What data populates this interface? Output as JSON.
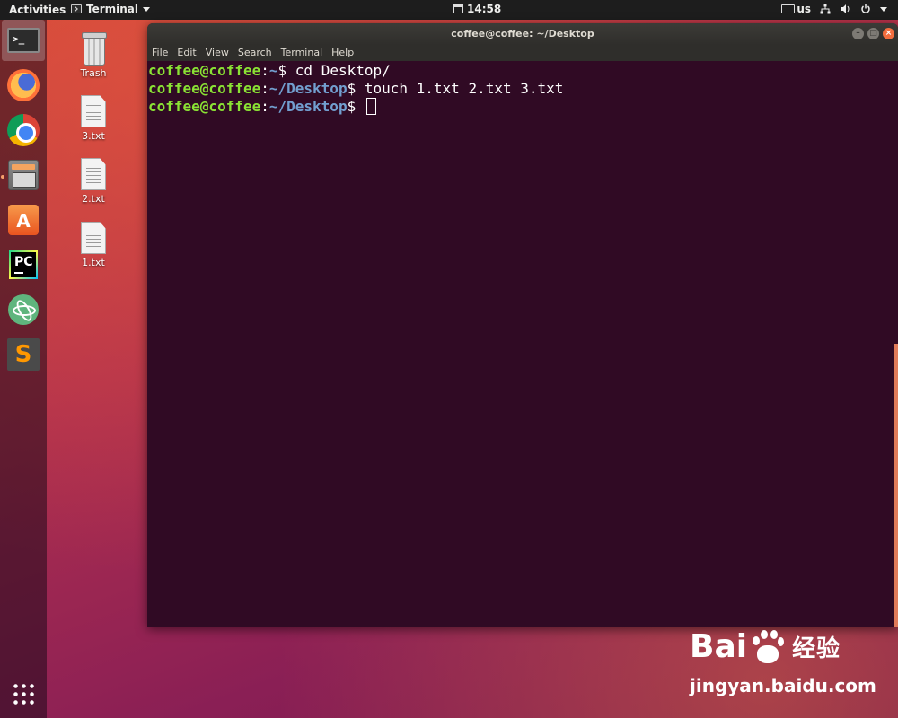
{
  "topbar": {
    "activities": "Activities",
    "app_menu": "Terminal",
    "clock": "14:58",
    "keyboard_layout": "us"
  },
  "dock": {
    "items": [
      {
        "name": "terminal",
        "icon": "terminal-icon",
        "glyph": ">_",
        "active": true
      },
      {
        "name": "firefox",
        "icon": "firefox-icon"
      },
      {
        "name": "chrome",
        "icon": "chrome-icon"
      },
      {
        "name": "files",
        "icon": "files-icon"
      },
      {
        "name": "ubuntu-software",
        "icon": "software-center-icon",
        "glyph": "A"
      },
      {
        "name": "pycharm",
        "icon": "pycharm-icon",
        "glyph": "PC"
      },
      {
        "name": "atom",
        "icon": "atom-icon"
      },
      {
        "name": "sublime-text",
        "icon": "sublime-icon",
        "glyph": "S"
      },
      {
        "name": "show-applications",
        "icon": "app-grid-icon"
      }
    ]
  },
  "desktop": {
    "icons": [
      {
        "label": "Trash",
        "icon": "trash-icon"
      },
      {
        "label": "3.txt",
        "icon": "text-file-icon"
      },
      {
        "label": "2.txt",
        "icon": "text-file-icon"
      },
      {
        "label": "1.txt",
        "icon": "text-file-icon"
      }
    ]
  },
  "terminal": {
    "title": "coffee@coffee: ~/Desktop",
    "menu": [
      "File",
      "Edit",
      "View",
      "Search",
      "Terminal",
      "Help"
    ],
    "lines": [
      {
        "user": "coffee@coffee",
        "sep": ":",
        "path": "~",
        "sigil": "$",
        "command": " cd Desktop/"
      },
      {
        "user": "coffee@coffee",
        "sep": ":",
        "path": "~/Desktop",
        "sigil": "$",
        "command": " touch 1.txt 2.txt 3.txt"
      },
      {
        "user": "coffee@coffee",
        "sep": ":",
        "path": "~/Desktop",
        "sigil": "$",
        "command": " "
      }
    ],
    "colors": {
      "background": "#300a24",
      "user": "#8ae234",
      "path": "#729fcf",
      "text": "#ffffff"
    }
  },
  "watermark": {
    "brand_left": "Bai",
    "brand_right": "经验",
    "url": "jingyan.baidu.com"
  },
  "theme": {
    "accent": "#e95420",
    "topbar": "#1d1d1d"
  }
}
